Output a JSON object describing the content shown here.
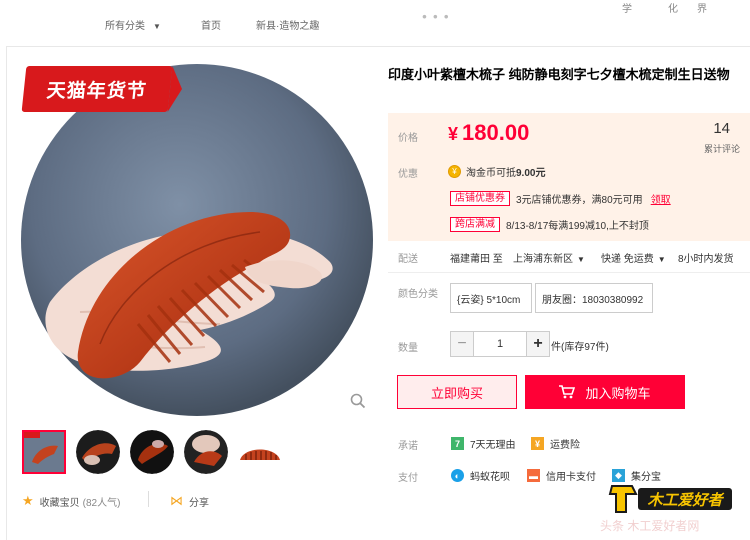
{
  "topnav": {
    "items": [
      "所有分类",
      "首页",
      "新县·造物之趣"
    ],
    "brand_fragment": "...",
    "brand_chars": [
      "学",
      "化",
      "界"
    ]
  },
  "badge": "天猫年货节",
  "product": {
    "title": "印度小叶紫檀木梳子 纯防静电刻字七夕檀木梳定制生日送物",
    "price_label": "价格",
    "price_currency": "¥",
    "price": "180.00",
    "reviews_count": "14",
    "reviews_label": "累计评论"
  },
  "promotions": {
    "label": "优惠",
    "tjb": "淘金币可抵",
    "tjb_value": "9.00元",
    "coupon_tag": "店铺优惠券",
    "coupon_text": "3元店铺优惠券，满80元可用",
    "coupon_link": "领取",
    "cross_tag": "跨店满减",
    "cross_text": "8/13-8/17每满199减10,上不封顶"
  },
  "delivery": {
    "label": "配送",
    "from": "福建莆田 至",
    "to": "上海浦东新区",
    "shipping": "快递 免运费",
    "time": "8小时内发货"
  },
  "sku": {
    "label": "颜色分类",
    "options": [
      "{云姿} 5*10cm",
      "朋友圈：18030380992"
    ]
  },
  "quantity": {
    "label": "数量",
    "value": "1",
    "stock": "件(库存97件)",
    "minus": "−",
    "plus": "+"
  },
  "actions": {
    "buy": "立即购买",
    "cart": "加入购物车"
  },
  "services": {
    "promise_label": "承诺",
    "promise_items": [
      "7天无理由",
      "运费险"
    ],
    "pay_label": "支付",
    "pay_items": [
      "蚂蚁花呗",
      "信用卡支付",
      "集分宝"
    ]
  },
  "social": {
    "collect": "收藏宝贝",
    "popularity": "(82人气)",
    "share": "分享"
  },
  "watermark": {
    "logo": "木工爱好者",
    "text": "头条 木工爱好者网"
  },
  "colors": {
    "tmall_red": "#ff0036",
    "price_bg": "#fff2e8",
    "comb": "#c4421e"
  }
}
